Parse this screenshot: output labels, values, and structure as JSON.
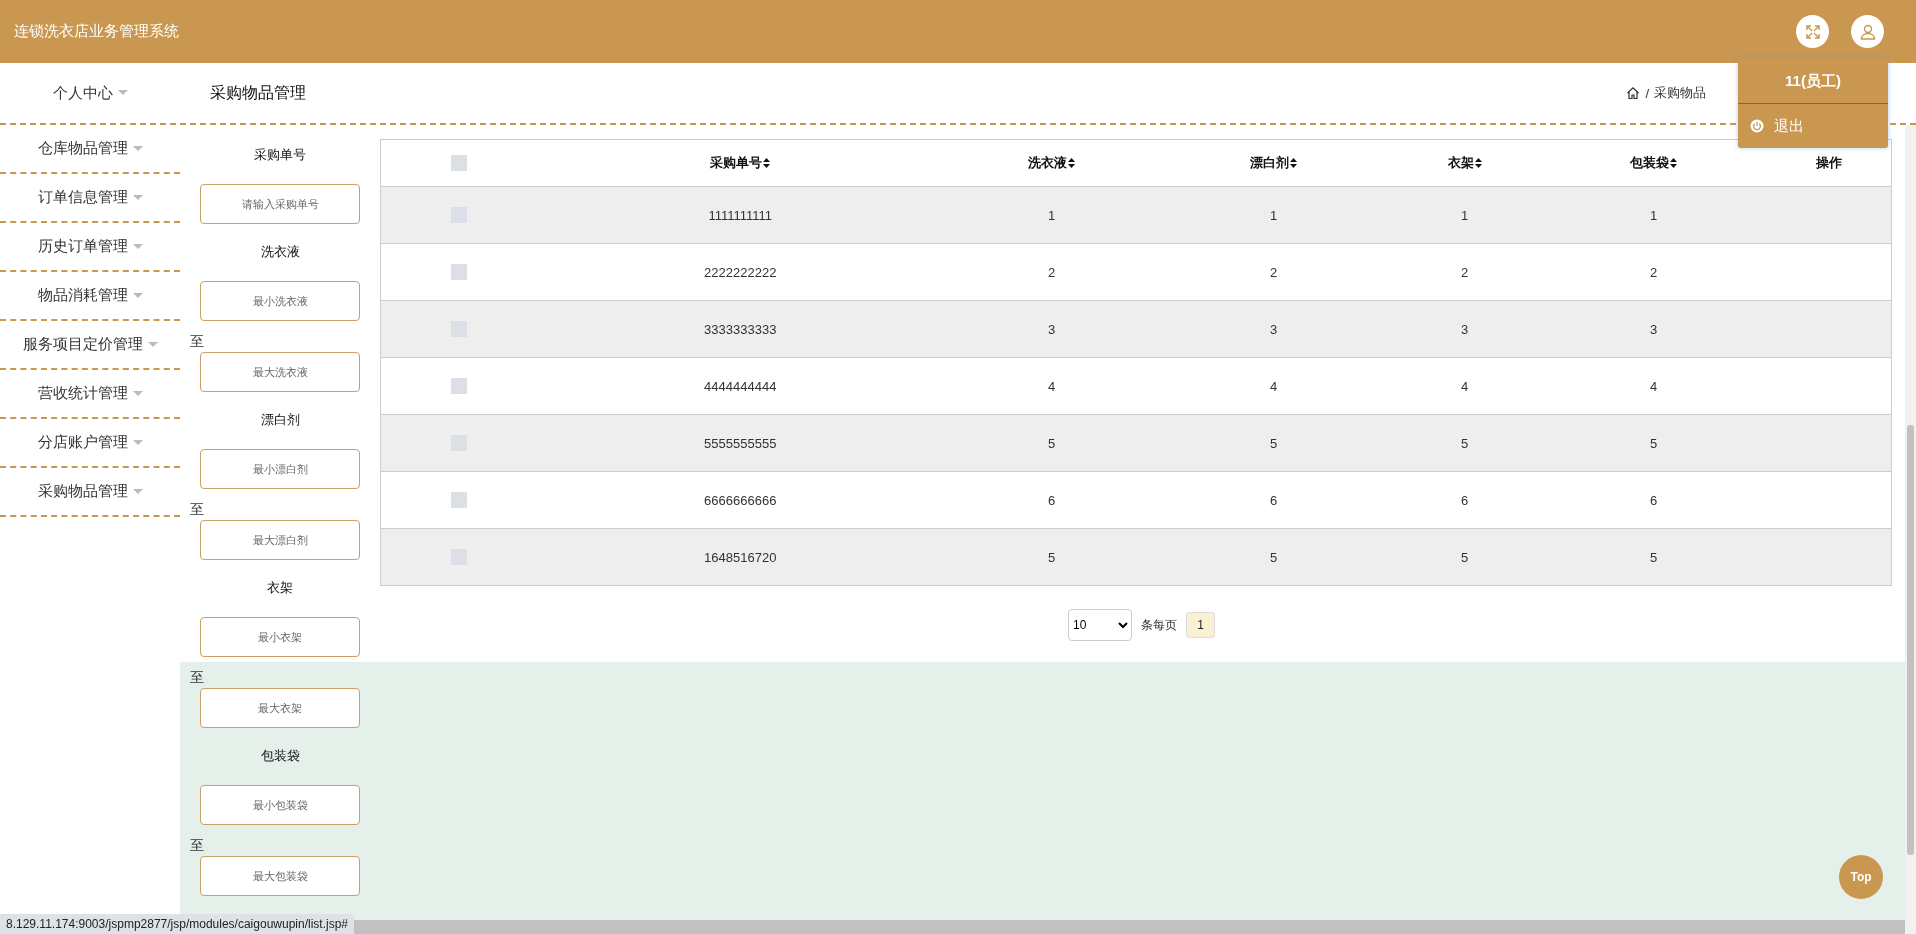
{
  "header": {
    "title": "连锁洗衣店业务管理系统"
  },
  "user_menu": {
    "user": "11(员工)",
    "logout": "退出"
  },
  "page_title": "采购物品管理",
  "breadcrumb": {
    "separator": "/",
    "current": "采购物品"
  },
  "sidebar": {
    "items": [
      {
        "label": "个人中心"
      },
      {
        "label": "仓库物品管理"
      },
      {
        "label": "订单信息管理"
      },
      {
        "label": "历史订单管理"
      },
      {
        "label": "物品消耗管理"
      },
      {
        "label": "服务项目定价管理"
      },
      {
        "label": "营收统计管理"
      },
      {
        "label": "分店账户管理"
      },
      {
        "label": "采购物品管理"
      }
    ]
  },
  "filters": [
    {
      "kind": "single",
      "label": "采购单号",
      "placeholder": "请输入采购单号"
    },
    {
      "kind": "range",
      "label": "洗衣液",
      "min_placeholder": "最小洗衣液",
      "separator": "至",
      "max_placeholder": "最大洗衣液"
    },
    {
      "kind": "range",
      "label": "漂白剂",
      "min_placeholder": "最小漂白剂",
      "separator": "至",
      "max_placeholder": "最大漂白剂"
    },
    {
      "kind": "range",
      "label": "衣架",
      "min_placeholder": "最小衣架",
      "separator": "至",
      "max_placeholder": "最大衣架"
    },
    {
      "kind": "range",
      "label": "包装袋",
      "min_placeholder": "最小包装袋",
      "separator": "至",
      "max_placeholder": "最大包装袋"
    }
  ],
  "table": {
    "select_all_checked": false,
    "columns": [
      {
        "label": "采购单号",
        "sortable": true
      },
      {
        "label": "洗衣液",
        "sortable": true
      },
      {
        "label": "漂白剂",
        "sortable": true
      },
      {
        "label": "衣架",
        "sortable": true
      },
      {
        "label": "包装袋",
        "sortable": true
      },
      {
        "label": "操作",
        "sortable": false
      }
    ],
    "rows": [
      {
        "checked": false,
        "cells": [
          "1111111111",
          "1",
          "1",
          "1",
          "1"
        ]
      },
      {
        "checked": false,
        "cells": [
          "2222222222",
          "2",
          "2",
          "2",
          "2"
        ]
      },
      {
        "checked": false,
        "cells": [
          "3333333333",
          "3",
          "3",
          "3",
          "3"
        ]
      },
      {
        "checked": false,
        "cells": [
          "4444444444",
          "4",
          "4",
          "4",
          "4"
        ]
      },
      {
        "checked": false,
        "cells": [
          "5555555555",
          "5",
          "5",
          "5",
          "5"
        ]
      },
      {
        "checked": false,
        "cells": [
          "6666666666",
          "6",
          "6",
          "6",
          "6"
        ]
      },
      {
        "checked": false,
        "cells": [
          "1648516720",
          "5",
          "5",
          "5",
          "5"
        ]
      }
    ]
  },
  "pagination": {
    "page_size": "10",
    "per_page_label": "条每页",
    "pages": [
      {
        "label": "1",
        "selected": true
      }
    ]
  },
  "top_button": "Top",
  "status_url": "8.129.11.174:9003/jspmp2877/jsp/modules/caigouwupin/list.jsp#"
}
